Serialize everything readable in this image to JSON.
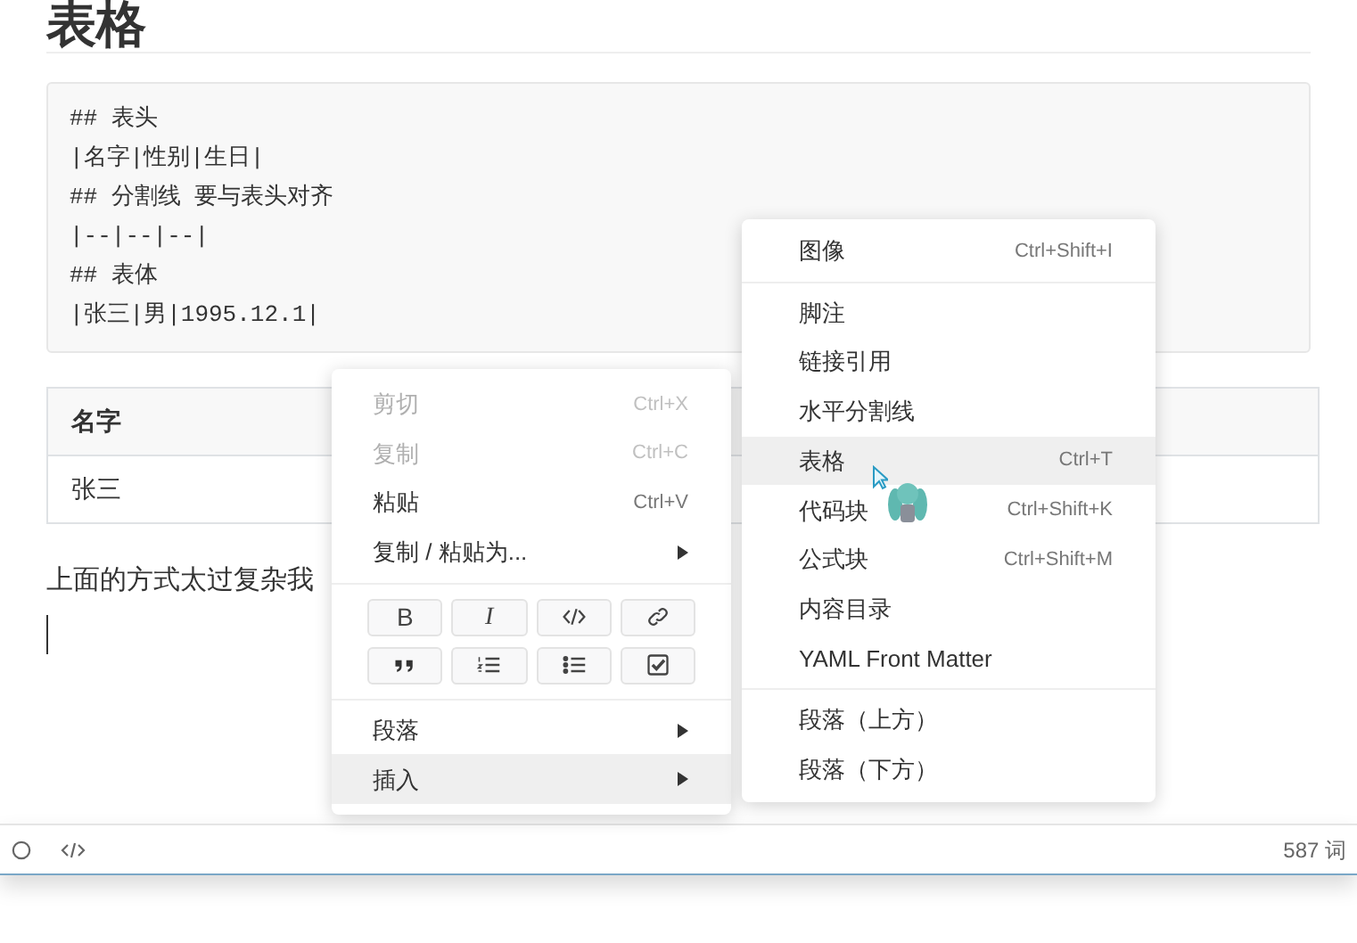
{
  "title": "表格",
  "code_lines": [
    "## 表头",
    "|名字|性别|生日|",
    "## 分割线 要与表头对齐",
    "|--|--|--|",
    "## 表体",
    "|张三|男|1995.12.1|"
  ],
  "table": {
    "columns": [
      "名字"
    ],
    "rows": [
      [
        "张三"
      ]
    ]
  },
  "paragraph": "上面的方式太过复杂我",
  "context_menu": {
    "items": [
      {
        "kind": "item",
        "label": "剪切",
        "shortcut": "Ctrl+X",
        "disabled": true,
        "selected": false
      },
      {
        "kind": "item",
        "label": "复制",
        "shortcut": "Ctrl+C",
        "disabled": true,
        "selected": false
      },
      {
        "kind": "item",
        "label": "粘贴",
        "shortcut": "Ctrl+V",
        "disabled": false,
        "selected": false
      },
      {
        "kind": "submenu",
        "label": "复制 / 粘贴为...",
        "disabled": false,
        "selected": false
      },
      {
        "kind": "separator"
      },
      {
        "kind": "format_buttons",
        "buttons": [
          {
            "kind": "bold",
            "label": "B"
          },
          {
            "kind": "italic",
            "label": "I"
          },
          {
            "kind": "code"
          },
          {
            "kind": "link"
          },
          {
            "kind": "quote"
          },
          {
            "kind": "ordered_list"
          },
          {
            "kind": "bullet_list"
          },
          {
            "kind": "task"
          }
        ]
      },
      {
        "kind": "separator"
      },
      {
        "kind": "submenu",
        "label": "段落",
        "disabled": false,
        "selected": false
      },
      {
        "kind": "submenu",
        "label": "插入",
        "disabled": false,
        "selected": true
      }
    ]
  },
  "insert_menu": {
    "items": [
      {
        "kind": "item",
        "label": "图像",
        "shortcut": "Ctrl+Shift+I",
        "selected": false
      },
      {
        "kind": "separator"
      },
      {
        "kind": "item",
        "label": "脚注",
        "selected": false
      },
      {
        "kind": "item",
        "label": "链接引用",
        "selected": false
      },
      {
        "kind": "item",
        "label": "水平分割线",
        "selected": false
      },
      {
        "kind": "item",
        "label": "表格",
        "shortcut": "Ctrl+T",
        "selected": true
      },
      {
        "kind": "item",
        "label": "代码块",
        "shortcut": "Ctrl+Shift+K",
        "selected": false
      },
      {
        "kind": "item",
        "label": "公式块",
        "shortcut": "Ctrl+Shift+M",
        "selected": false
      },
      {
        "kind": "item",
        "label": "内容目录",
        "selected": false
      },
      {
        "kind": "item",
        "label": "YAML Front Matter",
        "selected": false
      },
      {
        "kind": "separator"
      },
      {
        "kind": "item",
        "label": "段落（上方）",
        "selected": false
      },
      {
        "kind": "item",
        "label": "段落（下方）",
        "selected": false
      }
    ]
  },
  "status_bar": {
    "word_count": "587 词"
  }
}
